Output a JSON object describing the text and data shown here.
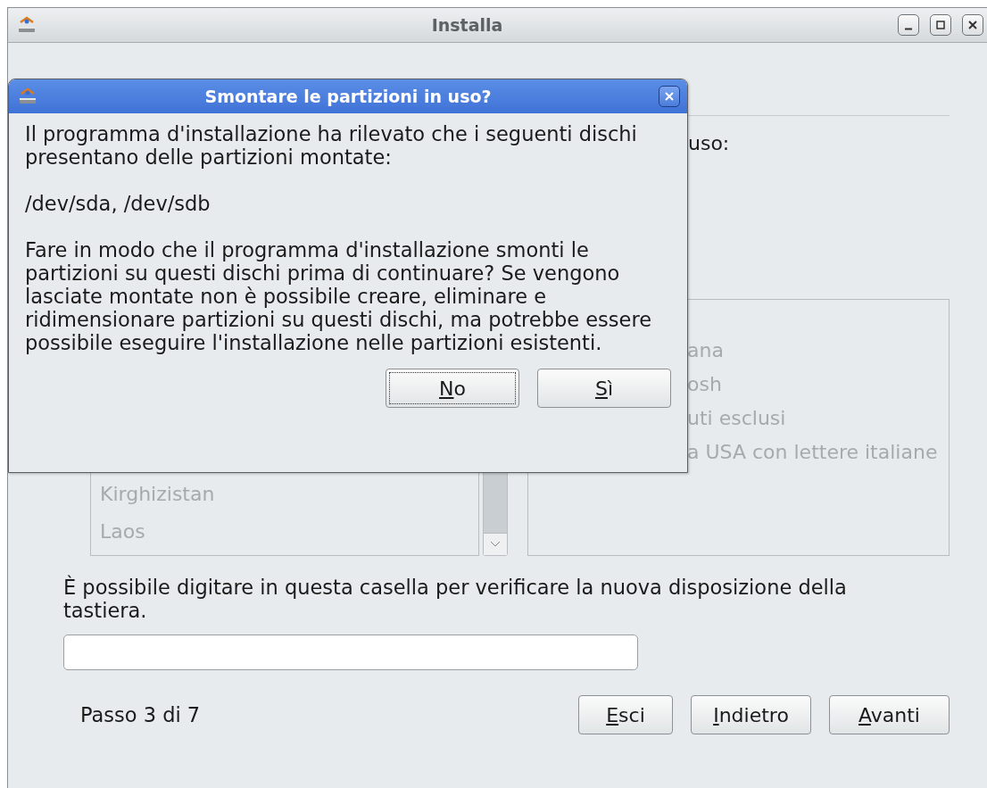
{
  "window": {
    "title": "Installa"
  },
  "background": {
    "heading_fragment": "uso:",
    "country_list": [
      "Kirghizistan",
      "Laos"
    ],
    "layout_list": [
      "ana",
      "osh",
      "uti esclusi",
      "a USA con lettere italiane"
    ],
    "test_label": "È possibile digitare in questa casella per verificare la nuova disposizione della tastiera.",
    "step": "Passo 3 di 7",
    "buttons": [
      {
        "label": "Esci",
        "access_key": true
      },
      {
        "label": "Indietro",
        "access_key": true
      },
      {
        "label": "Avanti",
        "access_key": true
      }
    ]
  },
  "dialog": {
    "title": "Smontare le partizioni in uso?",
    "paragraphs": [
      "Il programma d'installazione ha rilevato che i seguenti dischi presentano delle partizioni montate:",
      "/dev/sda, /dev/sdb",
      "Fare in modo che il programma d'installazione smonti le partizioni su questi dischi prima di continuare? Se vengono lasciate montate non è possibile creare, eliminare e ridimensionare partizioni su questi dischi, ma potrebbe essere possibile eseguire l'installazione nelle partizioni esistenti."
    ],
    "buttons": [
      {
        "label": "No",
        "access_key": true,
        "focused": true
      },
      {
        "label": "Sì",
        "access_key": true,
        "focused": false
      }
    ]
  }
}
